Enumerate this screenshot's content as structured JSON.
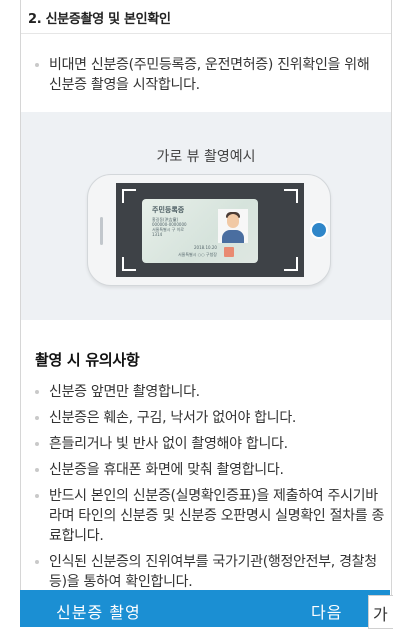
{
  "section": {
    "title": "2. 신분증촬영 및 본인확인",
    "intro": "비대면 신분증(주민등록증, 운전면허증) 진위확인을 위해 신분증 촬영을 시작합니다."
  },
  "example": {
    "title": "가로 뷰 촬영예시",
    "card": {
      "title": "주민등록증",
      "name": "홍길동(洪吉童)",
      "number": "000000-0000000",
      "address": "서울특별시 구 이로",
      "address2": "1314",
      "date": "2018.10.20",
      "issuer": "서울특별시 ○○ 구청장"
    }
  },
  "cautions": {
    "title": "촬영 시 유의사항",
    "items": [
      "신분증 앞면만 촬영합니다.",
      "신분증은 훼손, 구김, 낙서가 없어야 합니다.",
      "흔들리거나 빛 반사 없이 촬영해야 합니다.",
      "신분증을 휴대폰 화면에 맞춰 촬영합니다.",
      "반드시 본인의 신분증(실명확인증표)을 제출하여 주시기바라며 타인의 신분증 및 신분증 오판명시 실명확인 절차를 종료합니다.",
      "인식된 신분증의 진위여부를 국가기관(행정안전부, 경찰청 등)을 통하여 확인합니다."
    ]
  },
  "footer": {
    "primary_label": "신분증 촬영",
    "next_label": "다음",
    "edge_glyph": "가"
  },
  "colors": {
    "accent": "#1b8fd3",
    "panel": "#eef1f4",
    "screen": "#3e4247",
    "shutter": "#2f86c9"
  },
  "icons": {
    "bullet": "bullet-dot-icon",
    "shutter": "camera-shutter-icon",
    "avatar": "person-avatar-icon"
  }
}
